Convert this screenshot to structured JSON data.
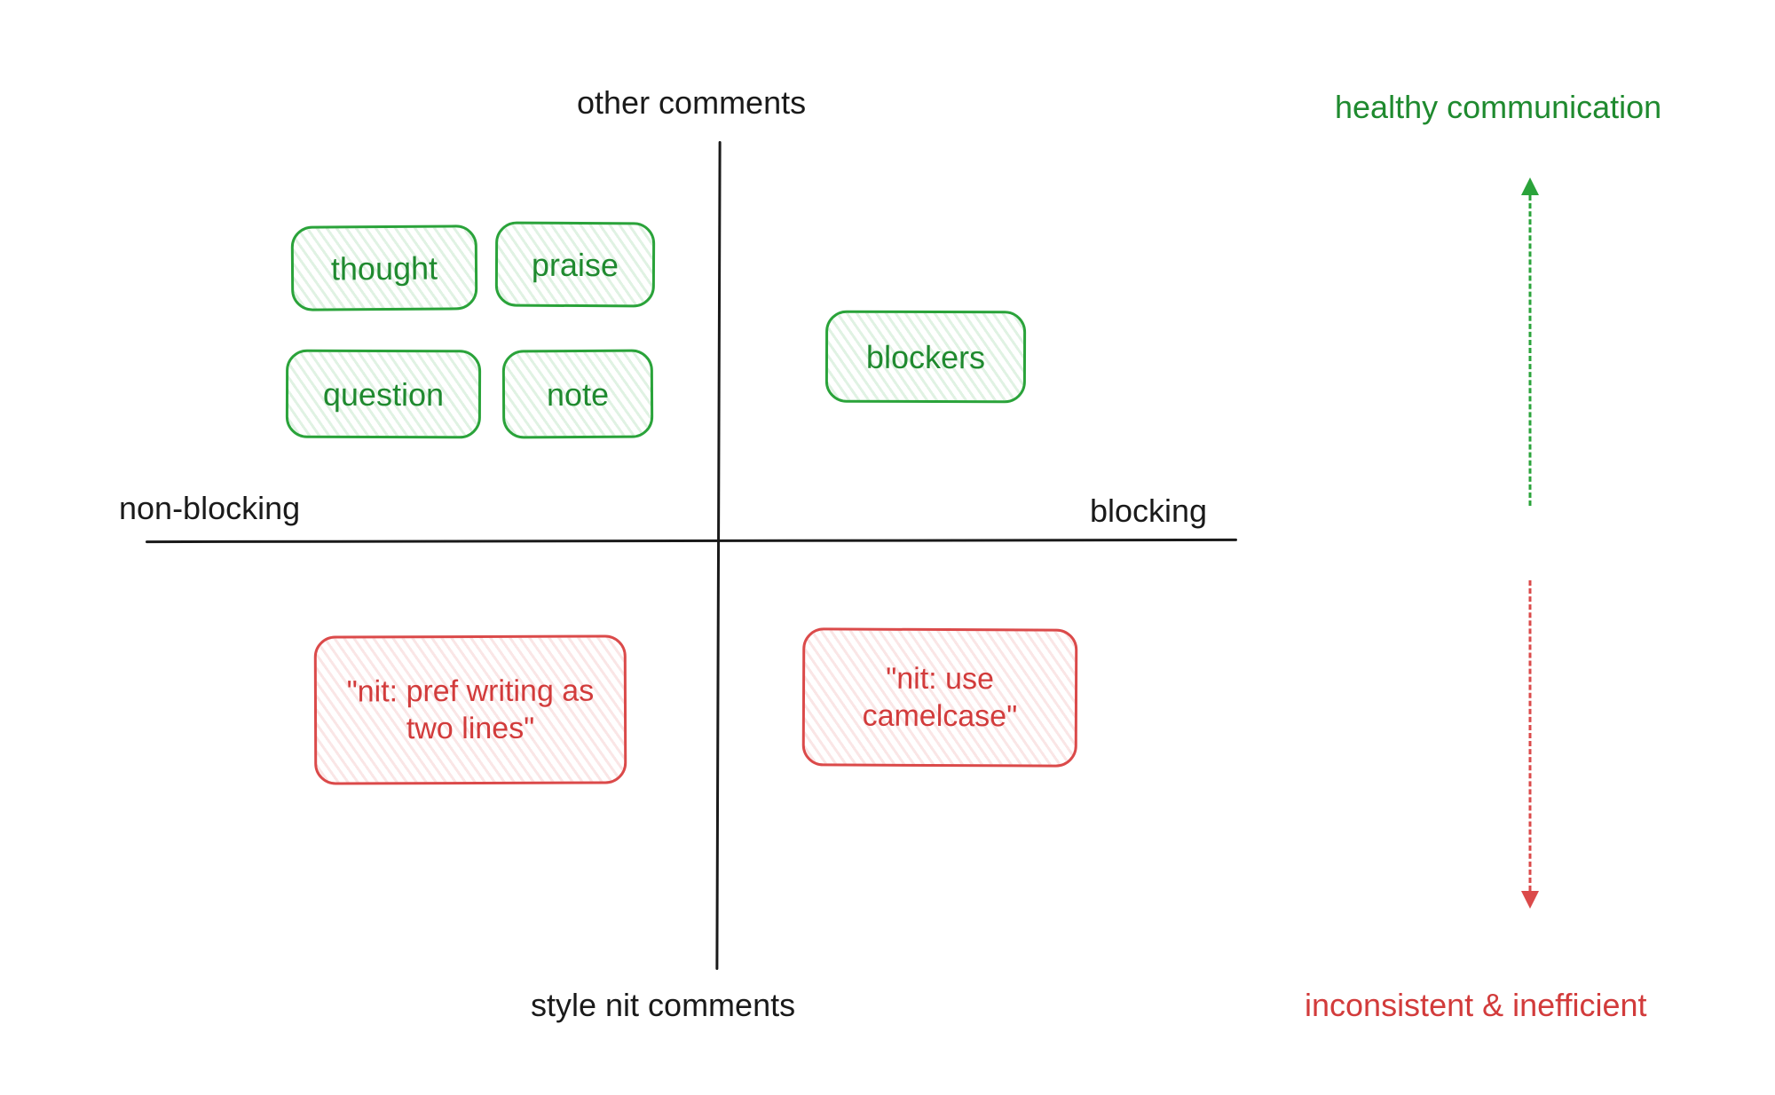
{
  "axes": {
    "top": "other comments",
    "bottom": "style nit comments",
    "left": "non-blocking",
    "right": "blocking"
  },
  "quadrants": {
    "top_left": {
      "color": "green",
      "items": [
        "thought",
        "praise",
        "question",
        "note"
      ]
    },
    "top_right": {
      "color": "green",
      "items": [
        "blockers"
      ]
    },
    "bottom_left": {
      "color": "red",
      "items": [
        "\"nit: pref writing as two lines\""
      ]
    },
    "bottom_right": {
      "color": "red",
      "items": [
        "\"nit: use camelcase\""
      ]
    }
  },
  "legend": {
    "top": "healthy communication",
    "bottom": "inconsistent & inefficient",
    "top_color": "#1f8a2f",
    "bottom_color": "#d23b3b"
  },
  "colors": {
    "green_stroke": "#2aa33a",
    "green_text": "#1f8a2f",
    "red_stroke": "#db4a4a",
    "red_text": "#d23b3b",
    "axis": "#1a1a1a"
  }
}
